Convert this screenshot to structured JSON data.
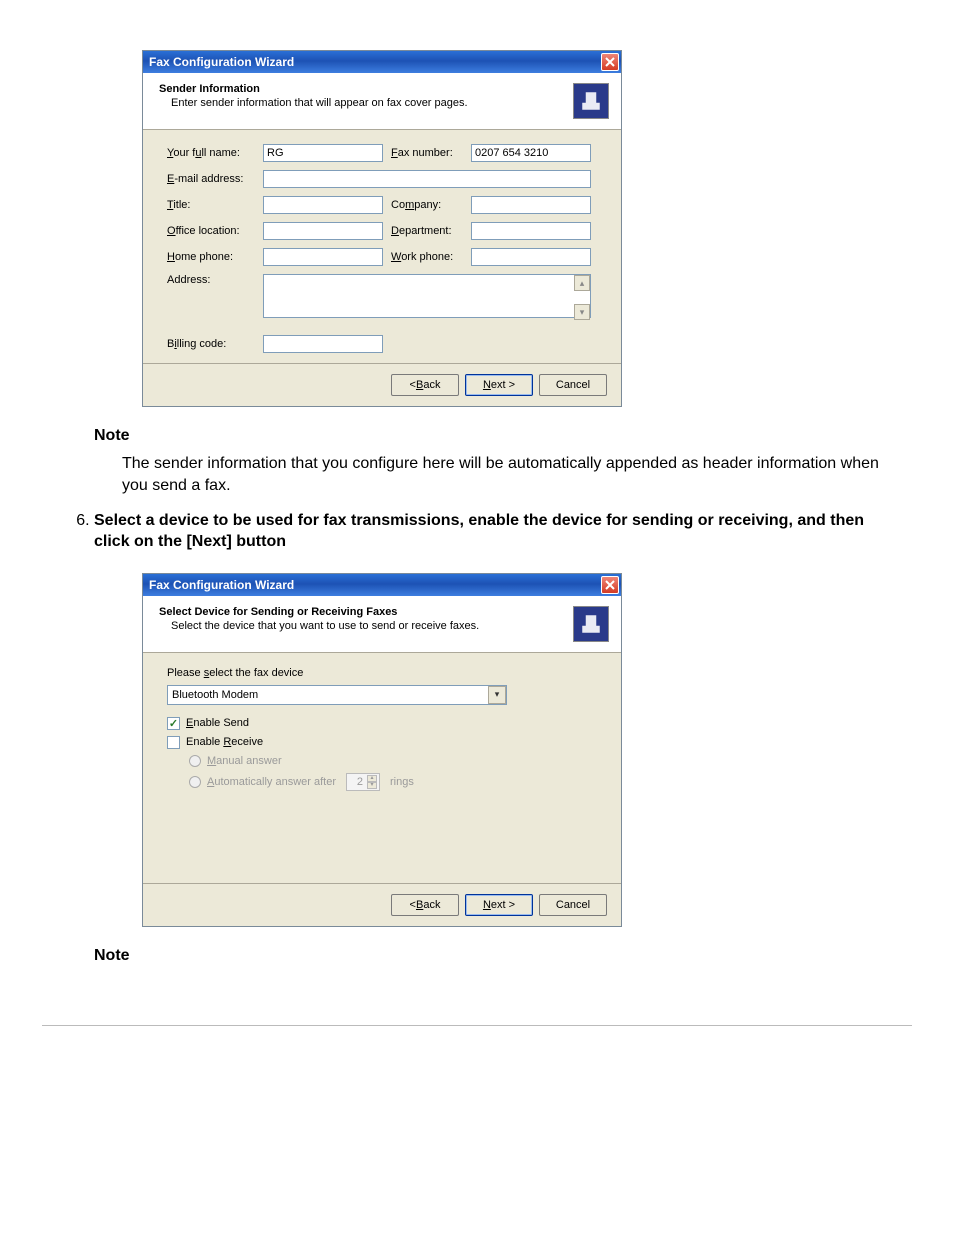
{
  "dialog1": {
    "title": "Fax Configuration Wizard",
    "header_title": "Sender Information",
    "header_sub": "Enter sender information that will appear on fax cover pages.",
    "labels": {
      "full_name": "Your full name:",
      "fax_number": "Fax number:",
      "email": "E-mail address:",
      "title": "Title:",
      "company": "Company:",
      "office": "Office location:",
      "department": "Department:",
      "home_phone": "Home phone:",
      "work_phone": "Work phone:",
      "address": "Address:",
      "billing": "Billing code:"
    },
    "values": {
      "full_name": "RG",
      "fax_number": "0207 654 3210",
      "email": "",
      "title": "",
      "company": "",
      "office": "",
      "department": "",
      "home_phone": "",
      "work_phone": "",
      "address": "",
      "billing": ""
    },
    "buttons": {
      "back": "< Back",
      "next": "Next >",
      "cancel": "Cancel"
    }
  },
  "doc": {
    "note_heading": "Note",
    "note_text1": "The sender information that you configure here will be automatically appended as header information when you send a fax.",
    "step6": "Select a device to be used for fax transmissions, enable the device for sending or receiving, and then click on the [Next] button",
    "note_heading2": "Note"
  },
  "dialog2": {
    "title": "Fax Configuration Wizard",
    "header_title": "Select Device for Sending or Receiving Faxes",
    "header_sub": "Select the device that you want to use to send or receive faxes.",
    "select_label": "Please select the fax device",
    "select_value": "Bluetooth Modem",
    "enable_send": "Enable Send",
    "enable_receive": "Enable Receive",
    "manual": "Manual answer",
    "auto_prefix": "Automatically answer after",
    "auto_rings_value": "2",
    "auto_suffix": "rings",
    "buttons": {
      "back": "< Back",
      "next": "Next >",
      "cancel": "Cancel"
    }
  }
}
